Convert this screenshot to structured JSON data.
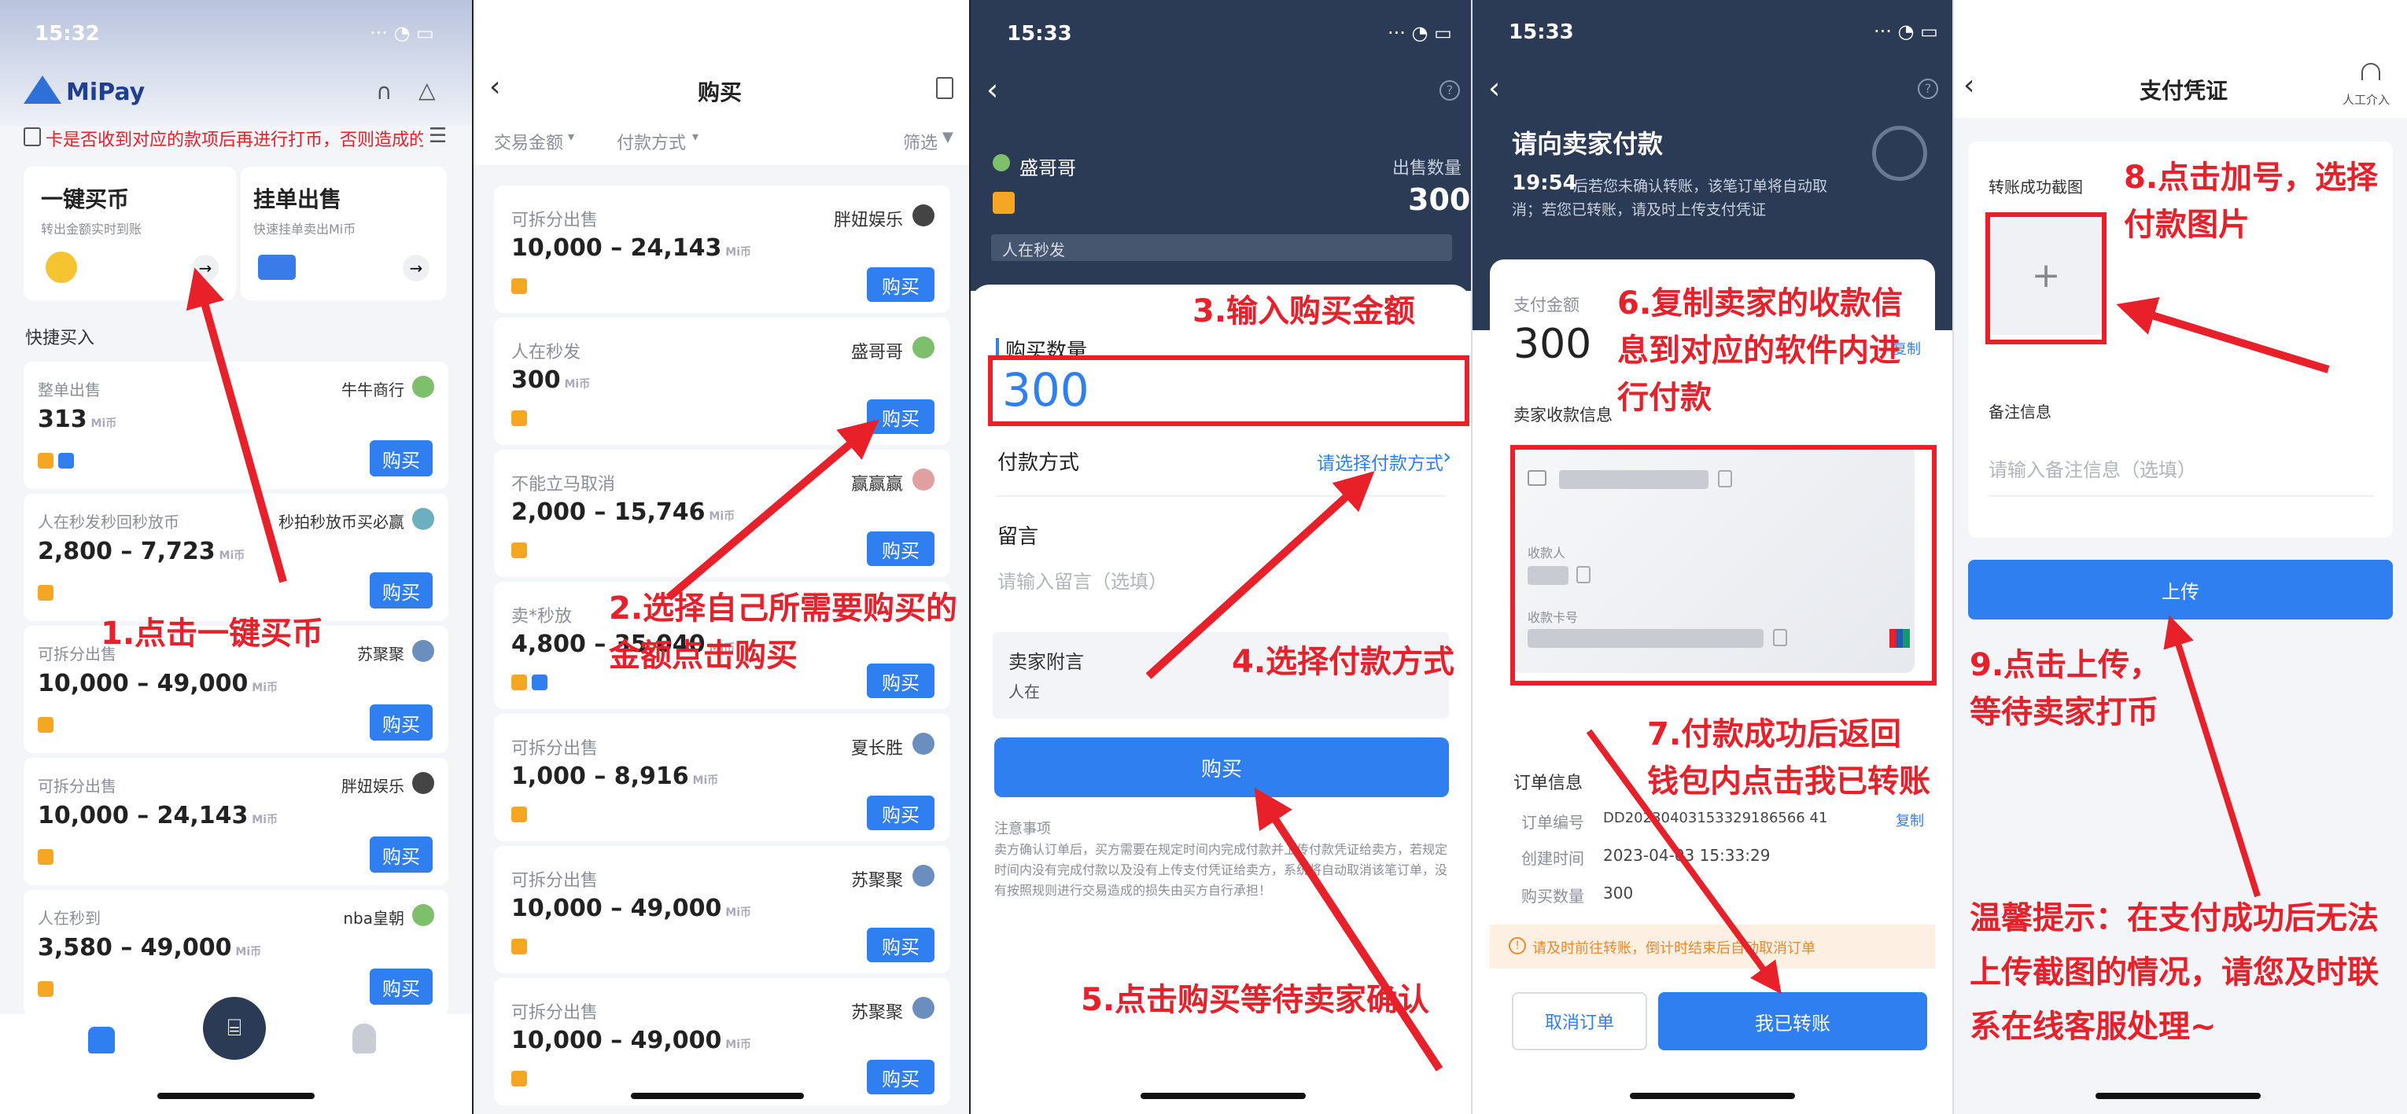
{
  "p1": {
    "time": "15:32",
    "app_name": "MiPay",
    "marquee": "卡是否收到对应的款项后再进行打币，否则造成的资金损",
    "onekey": {
      "title": "一键买币",
      "sub": "转出金额实时到账"
    },
    "list_sell": {
      "title": "挂单出售",
      "sub": "快速挂单卖出Mi币"
    },
    "quick_title": "快捷买入",
    "unit": "Mi币",
    "buy": "购买",
    "rows": [
      {
        "type": "整单出售",
        "amount": "313",
        "seller": "牛牛商行"
      },
      {
        "type": "人在秒发秒回秒放币",
        "amount": "2,800 – 7,723",
        "seller": "秒拍秒放币买必赢"
      },
      {
        "type": "可拆分出售",
        "amount": "10,000 – 49,000",
        "seller": "苏聚聚"
      },
      {
        "type": "可拆分出售",
        "amount": "10,000 – 24,143",
        "seller": "胖妞娱乐"
      },
      {
        "type": "人在秒到",
        "amount": "3,580 – 49,000",
        "seller": "nba皇朝"
      }
    ]
  },
  "p2": {
    "title": "购买",
    "filter_amount": "交易金额",
    "filter_pay": "付款方式",
    "filter": "筛选",
    "unit": "Mi币",
    "buy": "购买",
    "rows": [
      {
        "type": "可拆分出售",
        "amount": "10,000 – 24,143",
        "seller": "胖妞娱乐"
      },
      {
        "type": "人在秒发",
        "amount": "300",
        "seller": "盛哥哥"
      },
      {
        "type": "不能立马取消",
        "amount": "2,000 – 15,746",
        "seller": "赢赢赢"
      },
      {
        "type": "卖*秒放",
        "amount": "4,800 – 35,040",
        "seller": ""
      },
      {
        "type": "可拆分出售",
        "amount": "1,000 – 8,916",
        "seller": "夏长胜"
      },
      {
        "type": "可拆分出售",
        "amount": "10,000 – 49,000",
        "seller": "苏聚聚"
      },
      {
        "type": "可拆分出售",
        "amount": "10,000 – 49,000",
        "seller": "苏聚聚"
      }
    ]
  },
  "p3": {
    "time": "15:33",
    "seller": "盛哥哥",
    "sell_qty_label": "出售数量",
    "sell_qty": "300",
    "seller_tag": "人在秒发",
    "qty_label": "购买数量",
    "qty_value": "300",
    "pay_label": "付款方式",
    "pay_select": "请选择付款方式",
    "msg_label": "留言",
    "msg_placeholder": "请输入留言（选填）",
    "seller_note_label": "卖家附言",
    "seller_note": "人在",
    "buy_button": "购买",
    "notice_title": "注意事项",
    "notice_text": "卖方确认订单后，买方需要在规定时间内完成付款并上传付款凭证给卖方，若规定时间内没有完成付款以及没有上传支付凭证给卖方，系统将自动取消该笔订单，没有按照规则进行交易造成的损失由买方自行承担！"
  },
  "p4": {
    "time": "15:33",
    "title": "请向卖家付款",
    "countdown": "19:54",
    "desc": "后若您未确认转账，该笔订单将自动取消；若您已转账，请及时上传支付凭证",
    "pay_amount_label": "支付金额",
    "pay_amount": "300",
    "copy": "复制",
    "payee_info": "卖家收款信息",
    "payee_label": "收款人",
    "card_label": "收款卡号",
    "order_info": "订单信息",
    "order_no_label": "订单编号",
    "order_no": "DD20230403153329186566 41",
    "created_label": "创建时间",
    "created": "2023-04-03 15:33:29",
    "qty_label": "购买数量",
    "qty": "300",
    "warning": "请及时前往转账，倒计时结束后自动取消订单",
    "cancel": "取消订单",
    "paid": "我已转账"
  },
  "p5": {
    "title": "支付凭证",
    "support": "人工介入",
    "screenshot_label": "转账成功截图",
    "note_label": "备注信息",
    "note_placeholder": "请输入备注信息（选填）",
    "upload": "上传"
  },
  "annotations": {
    "a1": "1.点击一键买币",
    "a2": "2.选择自己所需要购买的金额点击购买",
    "a3": "3.输入购买金额",
    "a4": "4.选择付款方式",
    "a5": "5.点击购买等待卖家确认",
    "a6": "6.复制卖家的收款信息到对应的软件内进行付款",
    "a7": "7.付款成功后返回钱包内点击我已转账",
    "a8": "8.点击加号，选择付款图片",
    "a9": "9.点击上传，等待卖家打币",
    "tip": "温馨提示：在支付成功后无法上传截图的情况，请您及时联系在线客服处理~"
  },
  "colors": {
    "accent": "#2f7ff0",
    "annotation": "#e8202a",
    "dark_header": "#2b3a55"
  }
}
